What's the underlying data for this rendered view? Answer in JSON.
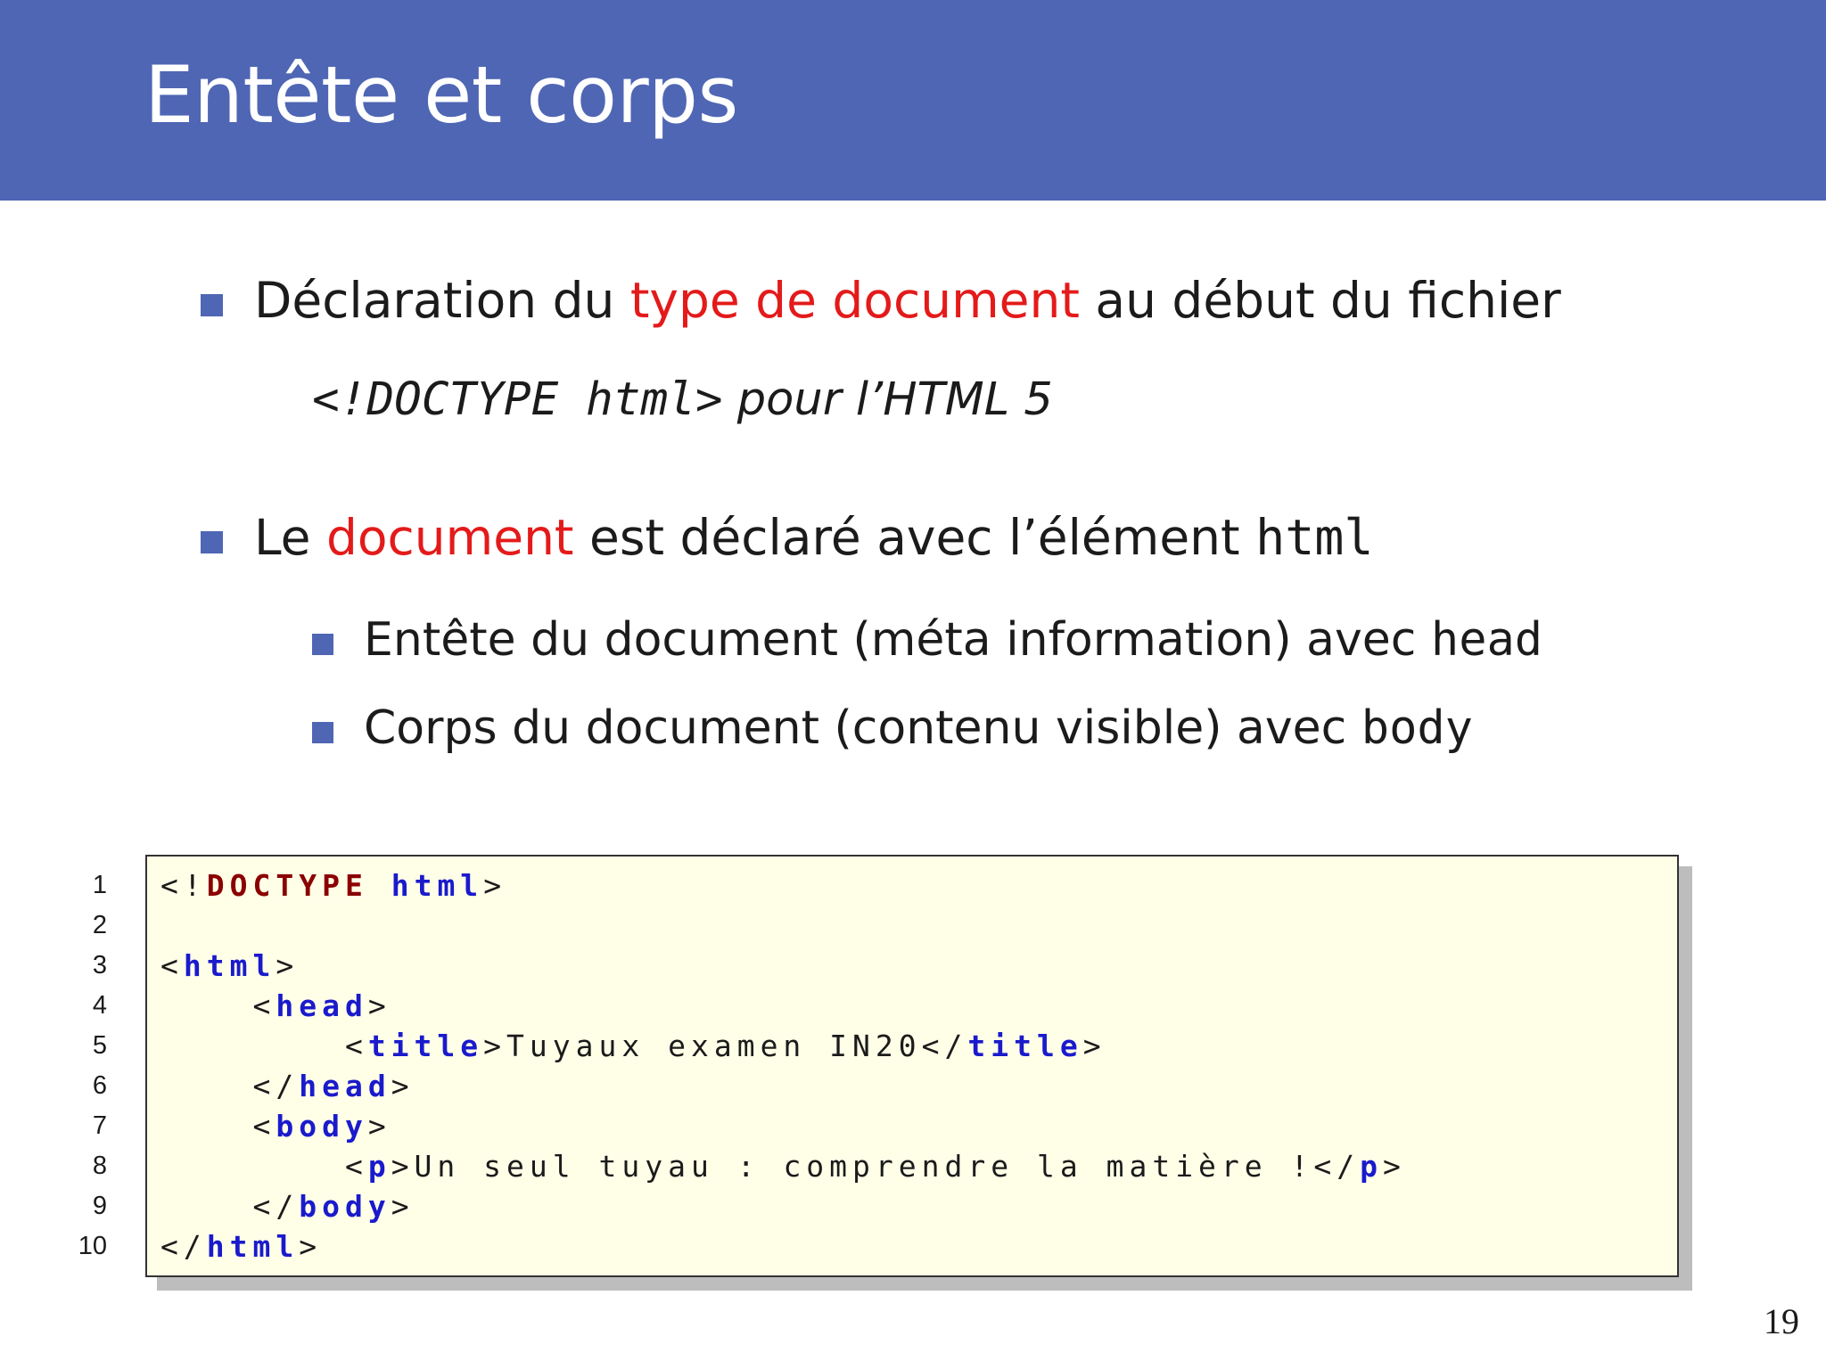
{
  "slide": {
    "title": "Entête et corps",
    "page_number": "19"
  },
  "bullets": {
    "b1_pre": "Déclaration du ",
    "b1_red": "type de document",
    "b1_post": " au début du fichier",
    "doctype_code": "<!DOCTYPE html>",
    "doctype_text": " pour l’HTML 5",
    "b2_pre": "Le ",
    "b2_red": "document",
    "b2_mid": " est déclaré avec l’élément ",
    "b2_code": "html",
    "sub1_text": "Entête du document (méta information) avec ",
    "sub1_code": "head",
    "sub2_text": "Corps du document (contenu visible) avec ",
    "sub2_code": "body"
  },
  "code": {
    "line_numbers": [
      "1",
      "2",
      "3",
      "4",
      "5",
      "6",
      "7",
      "8",
      "9",
      "10"
    ],
    "l1_open": "<!",
    "l1_doctype": "DOCTYPE",
    "l1_sp": " ",
    "l1_html": "html",
    "l1_close": ">",
    "l3_open": "<",
    "l3_tag": "html",
    "l3_close": ">",
    "l4_open": "    <",
    "l4_tag": "head",
    "l4_close": ">",
    "l5_open": "        <",
    "l5_tag": "title",
    "l5_mid": ">Tuyaux examen IN20</",
    "l5_tag2": "title",
    "l5_close": ">",
    "l6_open": "    </",
    "l6_tag": "head",
    "l6_close": ">",
    "l7_open": "    <",
    "l7_tag": "body",
    "l7_close": ">",
    "l8_open": "        <",
    "l8_tag": "p",
    "l8_mid": ">Un seul tuyau : comprendre la matière !</",
    "l8_tag2": "p",
    "l8_close": ">",
    "l9_open": "    </",
    "l9_tag": "body",
    "l9_close": ">",
    "l10_open": "</",
    "l10_tag": "html",
    "l10_close": ">"
  },
  "colors": {
    "header_bg": "#4f66b4",
    "highlight_red": "#e41a1a",
    "code_bg": "#ffffe8",
    "keyword_blue": "#1a1acc",
    "doctype_darkred": "#8b0000"
  }
}
